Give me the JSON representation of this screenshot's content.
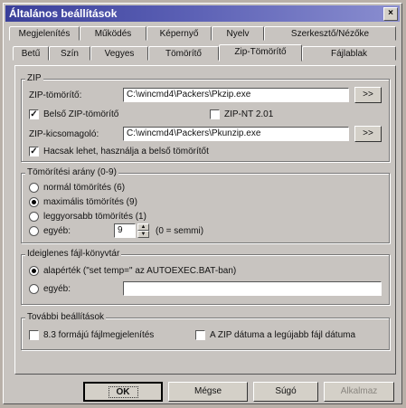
{
  "window": {
    "title": "Általános beállítások",
    "close_glyph": "×"
  },
  "tabs_row1": [
    "Megjelenítés",
    "Működés",
    "Képernyő",
    "Nyelv",
    "Szerkesztő/Nézőke"
  ],
  "tabs_row2": [
    "Betű",
    "Szín",
    "Vegyes",
    "Tömörítő",
    "Zip-Tömörítő",
    "Fájlablak"
  ],
  "active_tab": "Zip-Tömörítő",
  "zip": {
    "legend": "ZIP",
    "packer_label": "ZIP-tömörítő:",
    "packer_value": "C:\\wincmd4\\Packers\\Pkzip.exe",
    "browse_label": ">>",
    "internal_label": "Belső ZIP-tömörítő",
    "internal_checked": true,
    "nt_label": "ZIP-NT 2.01",
    "nt_checked": false,
    "unpacker_label": "ZIP-kicsomagoló:",
    "unpacker_value": "C:\\wincmd4\\Packers\\Pkunzip.exe",
    "only_internal_label": "Hacsak lehet, használja a belső tömörítőt",
    "only_internal_checked": true
  },
  "ratio": {
    "legend": "Tömörítési arány (0-9)",
    "options": [
      "normál tömörítés (6)",
      "maximális tömörítés (9)",
      "leggyorsabb tömörítés (1)",
      "egyéb:"
    ],
    "selected": 1,
    "other_value": "9",
    "other_hint": "(0 = semmi)"
  },
  "temp": {
    "legend": "Ideiglenes fájl-könyvtár",
    "options": [
      "alapérték (\"set temp=\" az AUTOEXEC.BAT-ban)",
      "egyéb:"
    ],
    "selected": 0,
    "other_value": ""
  },
  "more": {
    "legend": "További beállítások",
    "opt1_label": "8.3 formájú fájlmegjelenítés",
    "opt1_checked": false,
    "opt2_label": "A ZIP dátuma a legújabb fájl dátuma",
    "opt2_checked": false
  },
  "buttons": {
    "ok": "OK",
    "cancel": "Mégse",
    "help": "Súgó",
    "apply": "Alkalmaz"
  }
}
